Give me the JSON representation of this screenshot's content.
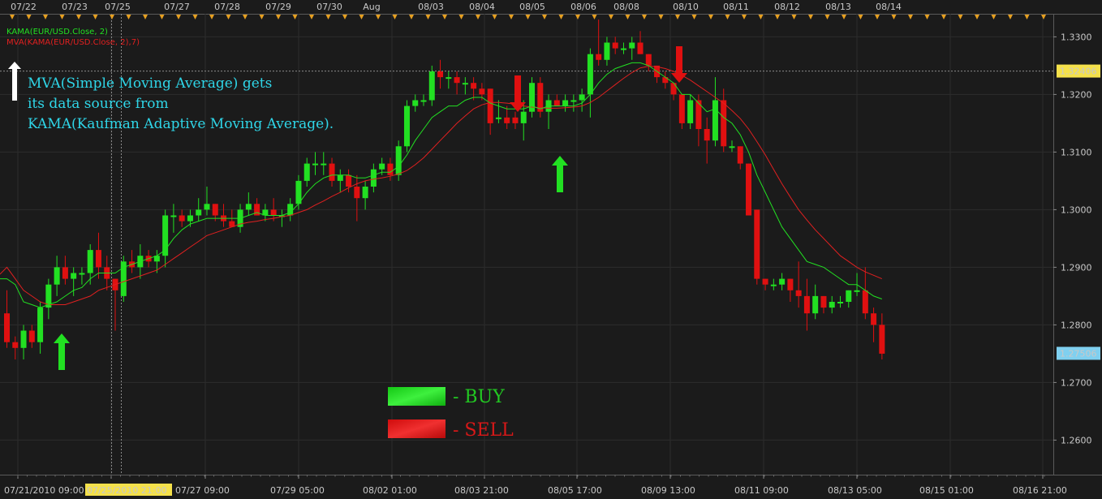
{
  "chart_data": {
    "type": "candlestick",
    "instrument": "EUR/USD",
    "top_dates": [
      "07/22",
      "07/23",
      "07/25",
      "07/27",
      "07/28",
      "07/29",
      "07/30",
      "Aug",
      "08/03",
      "08/04",
      "08/05",
      "08/06",
      "08/08",
      "08/10",
      "08/11",
      "08/12",
      "08/13",
      "08/14"
    ],
    "bottom_dates": [
      "07/21/2010 09:00",
      "07/25/2010 21:00",
      "07/27 09:00",
      "07/29 05:00",
      "08/02 01:00",
      "08/03 21:00",
      "08/05 17:00",
      "08/09 13:00",
      "08/11 09:00",
      "08/13 05:00",
      "08/15 01:00",
      "08/16 21:00"
    ],
    "highlighted_date": "07/25/2010 21:00",
    "y_ticks": [
      "1.3300",
      "1.3200",
      "1.3100",
      "1.3000",
      "1.2900",
      "1.2800",
      "1.2700",
      "1.2600"
    ],
    "ylim": [
      1.254,
      1.334
    ],
    "current_price_label": "1.32406",
    "current_price": 1.32406,
    "last_price_label": "1.27506",
    "last_price": 1.27506,
    "indicators": [
      {
        "name": "KAMA(EUR/USD.Close, 2)",
        "color": "#22e022"
      },
      {
        "name": "MVA(KAMA(EUR/USD.Close, 2),7)",
        "color": "#e02020"
      }
    ],
    "annotation": {
      "line1": "MVA(Simple Moving Average) gets",
      "line2": "its data source from",
      "line3": "KAMA(Kaufman Adaptive Moving Average)."
    },
    "buy_label": "- BUY",
    "sell_label": "- SELL",
    "colors": {
      "bull": "#22e022",
      "bear": "#e01010",
      "kama": "#22e022",
      "mva": "#e02020",
      "text": "#c8c8c8",
      "note": "#2fd6e8",
      "price_tag": "#f5e14a",
      "last_tag": "#7fd0f0"
    },
    "candles": [
      [
        1.282,
        1.286,
        1.276,
        1.277
      ],
      [
        1.277,
        1.278,
        1.274,
        1.276
      ],
      [
        1.276,
        1.28,
        1.274,
        1.279
      ],
      [
        1.279,
        1.28,
        1.276,
        1.277
      ],
      [
        1.277,
        1.284,
        1.275,
        1.283
      ],
      [
        1.283,
        1.288,
        1.281,
        1.287
      ],
      [
        1.287,
        1.292,
        1.285,
        1.29
      ],
      [
        1.29,
        1.292,
        1.287,
        1.288
      ],
      [
        1.288,
        1.29,
        1.285,
        1.289
      ],
      [
        1.289,
        1.29,
        1.287,
        1.289
      ],
      [
        1.289,
        1.294,
        1.287,
        1.293
      ],
      [
        1.293,
        1.296,
        1.288,
        1.29
      ],
      [
        1.29,
        1.292,
        1.286,
        1.288
      ],
      [
        1.288,
        1.287,
        1.279,
        1.286
      ],
      [
        1.285,
        1.292,
        1.284,
        1.291
      ],
      [
        1.291,
        1.293,
        1.289,
        1.29
      ],
      [
        1.29,
        1.294,
        1.288,
        1.292
      ],
      [
        1.292,
        1.293,
        1.29,
        1.291
      ],
      [
        1.291,
        1.293,
        1.289,
        1.292
      ],
      [
        1.292,
        1.3,
        1.29,
        1.299
      ],
      [
        1.299,
        1.301,
        1.296,
        1.299
      ],
      [
        1.299,
        1.3,
        1.297,
        1.298
      ],
      [
        1.298,
        1.3,
        1.297,
        1.299
      ],
      [
        1.299,
        1.302,
        1.298,
        1.3
      ],
      [
        1.3,
        1.304,
        1.299,
        1.301
      ],
      [
        1.301,
        1.301,
        1.298,
        1.299
      ],
      [
        1.299,
        1.301,
        1.297,
        1.298
      ],
      [
        1.298,
        1.3,
        1.297,
        1.297
      ],
      [
        1.297,
        1.301,
        1.296,
        1.3
      ],
      [
        1.3,
        1.303,
        1.299,
        1.301
      ],
      [
        1.301,
        1.302,
        1.299,
        1.299
      ],
      [
        1.299,
        1.301,
        1.298,
        1.3
      ],
      [
        1.3,
        1.302,
        1.298,
        1.299
      ],
      [
        1.299,
        1.3,
        1.297,
        1.299
      ],
      [
        1.299,
        1.302,
        1.298,
        1.301
      ],
      [
        1.301,
        1.306,
        1.3,
        1.305
      ],
      [
        1.305,
        1.309,
        1.304,
        1.308
      ],
      [
        1.308,
        1.31,
        1.306,
        1.308
      ],
      [
        1.308,
        1.31,
        1.306,
        1.308
      ],
      [
        1.308,
        1.309,
        1.304,
        1.305
      ],
      [
        1.305,
        1.307,
        1.303,
        1.306
      ],
      [
        1.306,
        1.307,
        1.303,
        1.304
      ],
      [
        1.304,
        1.306,
        1.298,
        1.302
      ],
      [
        1.302,
        1.305,
        1.3,
        1.304
      ],
      [
        1.304,
        1.308,
        1.303,
        1.307
      ],
      [
        1.307,
        1.309,
        1.306,
        1.308
      ],
      [
        1.308,
        1.309,
        1.305,
        1.306
      ],
      [
        1.306,
        1.312,
        1.305,
        1.311
      ],
      [
        1.311,
        1.319,
        1.31,
        1.318
      ],
      [
        1.318,
        1.32,
        1.317,
        1.319
      ],
      [
        1.319,
        1.32,
        1.318,
        1.319
      ],
      [
        1.319,
        1.325,
        1.318,
        1.324
      ],
      [
        1.324,
        1.326,
        1.321,
        1.323
      ],
      [
        1.323,
        1.324,
        1.321,
        1.323
      ],
      [
        1.323,
        1.324,
        1.32,
        1.322
      ],
      [
        1.322,
        1.323,
        1.32,
        1.322
      ],
      [
        1.322,
        1.323,
        1.319,
        1.321
      ],
      [
        1.321,
        1.322,
        1.319,
        1.32
      ],
      [
        1.321,
        1.321,
        1.313,
        1.315
      ],
      [
        1.316,
        1.319,
        1.315,
        1.316
      ],
      [
        1.316,
        1.318,
        1.314,
        1.315
      ],
      [
        1.316,
        1.317,
        1.314,
        1.315
      ],
      [
        1.315,
        1.319,
        1.312,
        1.317
      ],
      [
        1.317,
        1.323,
        1.316,
        1.322
      ],
      [
        1.322,
        1.323,
        1.316,
        1.317
      ],
      [
        1.317,
        1.32,
        1.314,
        1.319
      ],
      [
        1.319,
        1.32,
        1.318,
        1.318
      ],
      [
        1.318,
        1.32,
        1.317,
        1.319
      ],
      [
        1.319,
        1.32,
        1.317,
        1.319
      ],
      [
        1.319,
        1.321,
        1.317,
        1.32
      ],
      [
        1.32,
        1.328,
        1.316,
        1.327
      ],
      [
        1.327,
        1.333,
        1.325,
        1.326
      ],
      [
        1.326,
        1.33,
        1.325,
        1.329
      ],
      [
        1.329,
        1.33,
        1.327,
        1.328
      ],
      [
        1.328,
        1.329,
        1.327,
        1.328
      ],
      [
        1.328,
        1.33,
        1.326,
        1.329
      ],
      [
        1.329,
        1.331,
        1.327,
        1.327
      ],
      [
        1.327,
        1.326,
        1.324,
        1.325
      ],
      [
        1.325,
        1.325,
        1.322,
        1.323
      ],
      [
        1.323,
        1.324,
        1.321,
        1.322
      ],
      [
        1.322,
        1.322,
        1.319,
        1.32
      ],
      [
        1.32,
        1.32,
        1.314,
        1.315
      ],
      [
        1.315,
        1.32,
        1.314,
        1.319
      ],
      [
        1.319,
        1.32,
        1.311,
        1.314
      ],
      [
        1.314,
        1.316,
        1.308,
        1.312
      ],
      [
        1.312,
        1.323,
        1.311,
        1.319
      ],
      [
        1.319,
        1.321,
        1.31,
        1.311
      ],
      [
        1.311,
        1.312,
        1.31,
        1.311
      ],
      [
        1.311,
        1.311,
        1.307,
        1.308
      ],
      [
        1.308,
        1.308,
        1.3,
        1.299
      ],
      [
        1.3,
        1.3,
        1.287,
        1.288
      ],
      [
        1.288,
        1.288,
        1.286,
        1.287
      ],
      [
        1.287,
        1.288,
        1.286,
        1.287
      ],
      [
        1.287,
        1.289,
        1.286,
        1.288
      ],
      [
        1.288,
        1.288,
        1.284,
        1.286
      ],
      [
        1.286,
        1.291,
        1.283,
        1.285
      ],
      [
        1.285,
        1.288,
        1.279,
        1.282
      ],
      [
        1.282,
        1.287,
        1.281,
        1.285
      ],
      [
        1.285,
        1.285,
        1.282,
        1.283
      ],
      [
        1.283,
        1.285,
        1.282,
        1.284
      ],
      [
        1.284,
        1.285,
        1.283,
        1.284
      ],
      [
        1.284,
        1.286,
        1.283,
        1.286
      ],
      [
        1.286,
        1.289,
        1.285,
        1.286
      ],
      [
        1.286,
        1.29,
        1.281,
        1.282
      ],
      [
        1.282,
        1.283,
        1.277,
        1.28
      ],
      [
        1.28,
        1.282,
        1.274,
        1.275
      ]
    ],
    "kama": [
      1.288,
      1.287,
      1.284,
      1.2835,
      1.283,
      1.2835,
      1.284,
      1.285,
      1.286,
      1.2865,
      1.288,
      1.289,
      1.289,
      1.289,
      1.29,
      1.2905,
      1.291,
      1.2915,
      1.292,
      1.293,
      1.295,
      1.2965,
      1.2975,
      1.298,
      1.2985,
      1.2985,
      1.2985,
      1.2985,
      1.2985,
      1.299,
      1.2995,
      1.299,
      1.299,
      1.299,
      1.2995,
      1.301,
      1.303,
      1.3045,
      1.3055,
      1.306,
      1.306,
      1.306,
      1.3055,
      1.3055,
      1.306,
      1.3065,
      1.3065,
      1.3075,
      1.3095,
      1.312,
      1.314,
      1.316,
      1.317,
      1.318,
      1.318,
      1.319,
      1.3195,
      1.3195,
      1.3185,
      1.318,
      1.3175,
      1.3175,
      1.3175,
      1.318,
      1.3175,
      1.318,
      1.318,
      1.318,
      1.318,
      1.3185,
      1.32,
      1.322,
      1.3235,
      1.3245,
      1.325,
      1.3255,
      1.3255,
      1.325,
      1.324,
      1.323,
      1.322,
      1.32,
      1.32,
      1.3185,
      1.317,
      1.3175,
      1.316,
      1.315,
      1.313,
      1.31,
      1.306,
      1.303,
      1.3,
      1.297,
      1.295,
      1.293,
      1.291,
      1.2905,
      1.29,
      1.289,
      1.288,
      1.287,
      1.287,
      1.286,
      1.285,
      1.2845
    ],
    "mva": [
      1.29,
      1.288,
      1.286,
      1.285,
      1.284,
      1.2835,
      1.2835,
      1.2835,
      1.284,
      1.2845,
      1.285,
      1.286,
      1.2865,
      1.287,
      1.2875,
      1.288,
      1.2885,
      1.289,
      1.2895,
      1.2905,
      1.2915,
      1.2925,
      1.2935,
      1.2945,
      1.2955,
      1.296,
      1.2965,
      1.297,
      1.2975,
      1.2978,
      1.298,
      1.2983,
      1.2985,
      1.2988,
      1.299,
      1.2995,
      1.3,
      1.3008,
      1.3015,
      1.3023,
      1.303,
      1.3038,
      1.3045,
      1.305,
      1.3053,
      1.3055,
      1.3058,
      1.3062,
      1.3068,
      1.3078,
      1.309,
      1.3105,
      1.312,
      1.3135,
      1.315,
      1.3163,
      1.3175,
      1.3182,
      1.3186,
      1.3186,
      1.3185,
      1.3183,
      1.318,
      1.3178,
      1.3177,
      1.3176,
      1.3176,
      1.3177,
      1.3178,
      1.318,
      1.3186,
      1.3195,
      1.3206,
      1.3217,
      1.3228,
      1.3238,
      1.3246,
      1.3249,
      1.3248,
      1.3245,
      1.324,
      1.3233,
      1.3225,
      1.3215,
      1.3205,
      1.3195,
      1.3185,
      1.3172,
      1.3158,
      1.314,
      1.3118,
      1.3095,
      1.307,
      1.3045,
      1.3022,
      1.3,
      1.2982,
      1.2965,
      1.295,
      1.2935,
      1.292,
      1.291,
      1.29,
      1.2892,
      1.2886,
      1.288
    ]
  }
}
